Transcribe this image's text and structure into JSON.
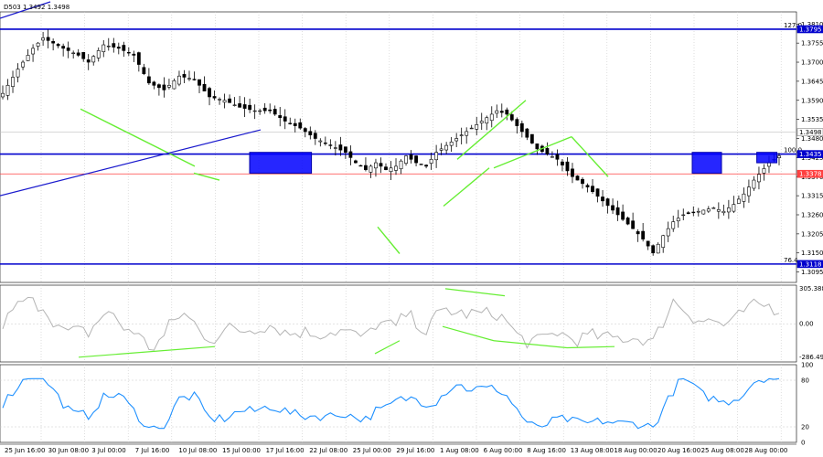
{
  "header": {
    "symbol_text": "D503 1.3492 1.3498"
  },
  "colors": {
    "candle": "#000000",
    "level_blue": "#0000cd",
    "level_red": "#ff4040",
    "box_blue": "#0000ff",
    "trend_green": "#66ee33",
    "trend_blue": "#1a1acd",
    "osc_gray": "#b4b4b4",
    "rsi_blue": "#1e90ff",
    "grid": "#c8c8c8"
  },
  "chart_data": [
    {
      "type": "candlestick",
      "title": "",
      "ylim": [
        1.3065,
        1.3845
      ],
      "y_ticks": [
        "1.3810",
        "1.3755",
        "1.3700",
        "1.3645",
        "1.3590",
        "1.3535",
        "1.3480",
        "1.3425",
        "1.3370",
        "1.3315",
        "1.3260",
        "1.3205",
        "1.3150",
        "1.3095"
      ],
      "price_tags": [
        {
          "value": 1.3795,
          "text": "1.3795",
          "style": "blue"
        },
        {
          "value": 1.3498,
          "text": "1.3498",
          "style": "gray"
        },
        {
          "value": 1.3435,
          "text": "1.3435",
          "style": "blue"
        },
        {
          "value": 1.3378,
          "text": "1.3378",
          "style": "red"
        },
        {
          "value": 1.3118,
          "text": "1.3118",
          "style": "blue"
        }
      ],
      "fib_levels": [
        {
          "value": 1.3795,
          "label": "127.0",
          "color": "level_blue"
        },
        {
          "value": 1.3435,
          "label": "100.0",
          "color": "level_blue"
        },
        {
          "value": 1.3378,
          "label": "",
          "color": "level_red"
        },
        {
          "value": 1.3118,
          "label": "76.4",
          "color": "level_blue"
        }
      ],
      "x_labels": [
        "25 Jun 16:00",
        "30 Jun 08:00",
        "3 Jul 00:00",
        "7 Jul 16:00",
        "10 Jul 08:00",
        "15 Jul 00:00",
        "17 Jul 16:00",
        "22 Jul 08:00",
        "25 Jul 00:00",
        "29 Jul 16:00",
        "1 Aug 08:00",
        "6 Aug 00:00",
        "8 Aug 16:00",
        "13 Aug 08:00",
        "18 Aug 00:00",
        "20 Aug 16:00",
        "25 Aug 08:00",
        "28 Aug 00:00"
      ],
      "bar_count": 155,
      "close_path": [
        [
          0,
          1.361
        ],
        [
          3,
          1.368
        ],
        [
          6,
          1.374
        ],
        [
          8,
          1.377
        ],
        [
          12,
          1.374
        ],
        [
          15,
          1.372
        ],
        [
          17,
          1.37
        ],
        [
          20,
          1.375
        ],
        [
          23,
          1.374
        ],
        [
          26,
          1.372
        ],
        [
          29,
          1.364
        ],
        [
          32,
          1.362
        ],
        [
          35,
          1.366
        ],
        [
          38,
          1.365
        ],
        [
          41,
          1.36
        ],
        [
          44,
          1.359
        ],
        [
          47,
          1.357
        ],
        [
          50,
          1.356
        ],
        [
          53,
          1.356
        ],
        [
          56,
          1.353
        ],
        [
          59,
          1.351
        ],
        [
          62,
          1.348
        ],
        [
          65,
          1.346
        ],
        [
          68,
          1.344
        ],
        [
          70,
          1.341
        ],
        [
          72,
          1.339
        ],
        [
          74,
          1.341
        ],
        [
          76,
          1.339
        ],
        [
          78,
          1.34
        ],
        [
          80,
          1.343
        ],
        [
          82,
          1.341
        ],
        [
          84,
          1.34
        ],
        [
          86,
          1.344
        ],
        [
          88,
          1.346
        ],
        [
          91,
          1.349
        ],
        [
          94,
          1.352
        ],
        [
          96,
          1.354
        ],
        [
          98,
          1.356
        ],
        [
          100,
          1.355
        ],
        [
          103,
          1.35
        ],
        [
          106,
          1.345
        ],
        [
          110,
          1.342
        ],
        [
          113,
          1.337
        ],
        [
          116,
          1.334
        ],
        [
          119,
          1.33
        ],
        [
          122,
          1.326
        ],
        [
          125,
          1.322
        ],
        [
          127,
          1.319
        ],
        [
          129,
          1.315
        ],
        [
          131,
          1.32
        ],
        [
          133,
          1.324
        ],
        [
          135,
          1.326
        ],
        [
          138,
          1.327
        ],
        [
          141,
          1.328
        ],
        [
          143,
          1.327
        ],
        [
          145,
          1.329
        ],
        [
          147,
          1.332
        ],
        [
          149,
          1.336
        ],
        [
          152,
          1.341
        ],
        [
          154,
          1.343
        ],
        [
          155,
          1.344
        ]
      ],
      "boxes": [
        {
          "x0": "15 Jul 00:00",
          "x1": "17 Jul 16:00",
          "y0": 1.338,
          "y1": 1.344
        },
        {
          "x0": "20 Aug 16:00",
          "x1": "20 Aug 16:00",
          "y0": 1.338,
          "y1": 1.344
        },
        {
          "x0": "25 Aug 08:00",
          "x1": "25 Aug 08:00",
          "y0": 1.341,
          "y1": 1.344
        }
      ]
    },
    {
      "type": "line",
      "title": "",
      "series": [
        {
          "name": "",
          "indicator": "CCI"
        }
      ],
      "y_ticks": [
        "305.3886",
        "0.00",
        "-286.493"
      ],
      "ylim": [
        -320,
        330
      ]
    },
    {
      "type": "line",
      "title": "",
      "series": [
        {
          "name": "",
          "indicator": "RSI"
        }
      ],
      "y_ticks": [
        "100",
        "80",
        "20",
        "0"
      ],
      "ylim": [
        0,
        100
      ]
    }
  ]
}
